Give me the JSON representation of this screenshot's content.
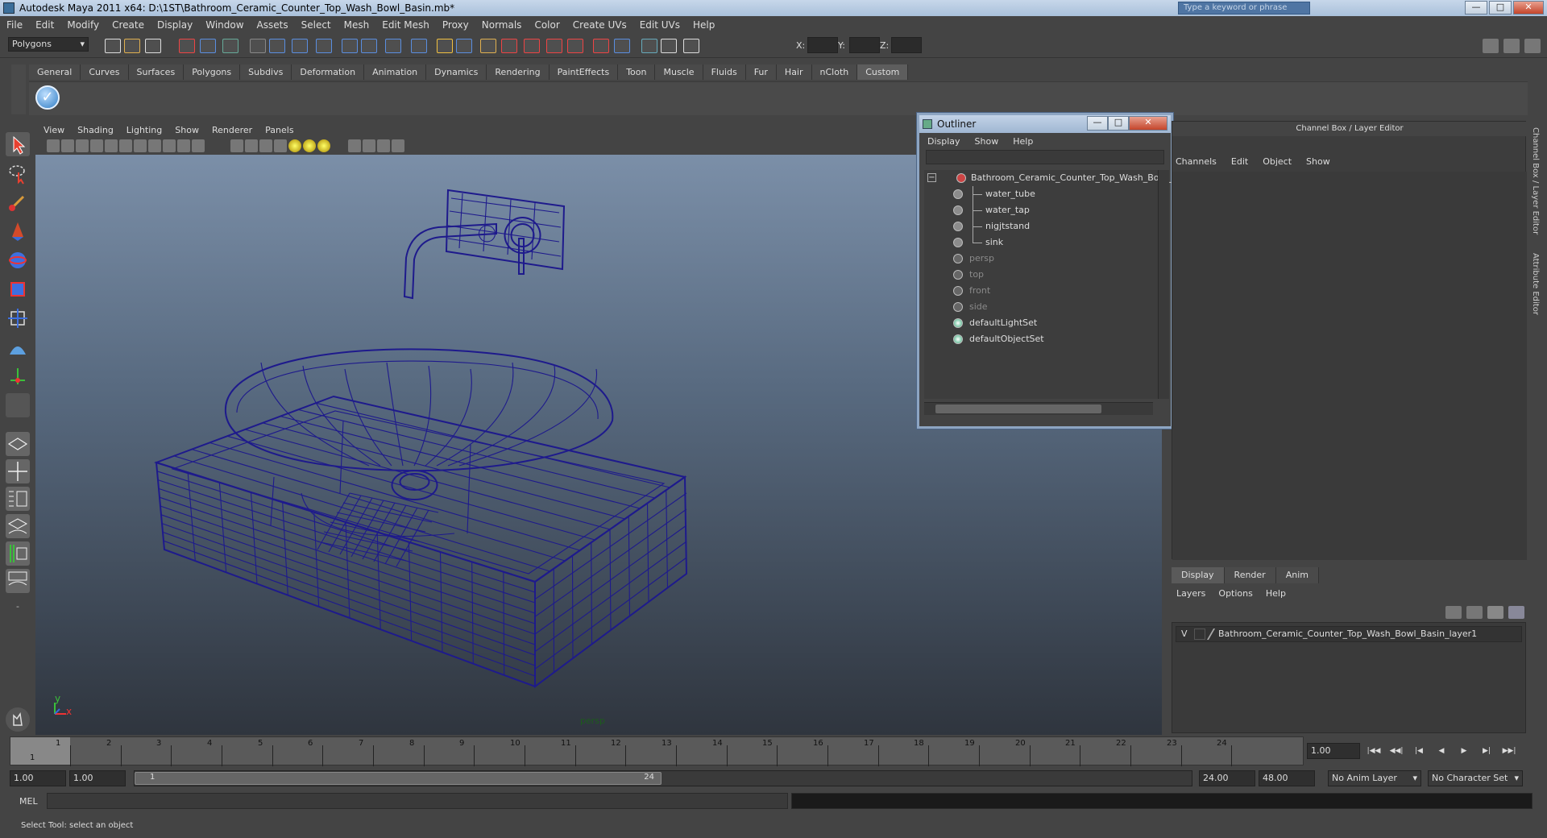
{
  "window": {
    "title": "Autodesk Maya 2011 x64: D:\\1ST\\Bathroom_Ceramic_Counter_Top_Wash_Bowl_Basin.mb*",
    "search_placeholder": "Type a keyword or phrase",
    "min_label": "—",
    "max_label": "□",
    "close_label": "✕"
  },
  "menu": [
    "File",
    "Edit",
    "Modify",
    "Create",
    "Display",
    "Window",
    "Assets",
    "Select",
    "Mesh",
    "Edit Mesh",
    "Proxy",
    "Normals",
    "Color",
    "Create UVs",
    "Edit UVs",
    "Help"
  ],
  "toolbar": {
    "mode": "Polygons",
    "x_label": "X:",
    "y_label": "Y:",
    "z_label": "Z:"
  },
  "shelf_tabs": [
    "General",
    "Curves",
    "Surfaces",
    "Polygons",
    "Subdivs",
    "Deformation",
    "Animation",
    "Dynamics",
    "Rendering",
    "PaintEffects",
    "Toon",
    "Muscle",
    "Fluids",
    "Fur",
    "Hair",
    "nCloth",
    "Custom"
  ],
  "shelf_active": "Custom",
  "viewport": {
    "menu": [
      "View",
      "Shading",
      "Lighting",
      "Show",
      "Renderer",
      "Panels"
    ],
    "camera": "persp",
    "axis_y": "y",
    "axis_x": "x",
    "wire_color": "#1e1a8c"
  },
  "outliner": {
    "title": "Outliner",
    "menu": [
      "Display",
      "Show",
      "Help"
    ],
    "root": "Bathroom_Ceramic_Counter_Top_Wash_Bowl_Basin",
    "children": [
      "water_tube",
      "water_tap",
      "nigjtstand",
      "sink"
    ],
    "cameras": [
      "persp",
      "top",
      "front",
      "side"
    ],
    "sets": [
      "defaultLightSet",
      "defaultObjectSet"
    ]
  },
  "channel_box": {
    "header": "Channel Box / Layer Editor",
    "menu": [
      "Channels",
      "Edit",
      "Object",
      "Show"
    ]
  },
  "layer_editor": {
    "tabs": [
      "Display",
      "Render",
      "Anim"
    ],
    "active_tab": "Display",
    "menu": [
      "Layers",
      "Options",
      "Help"
    ],
    "layer_visible": "V",
    "layer_name": "Bathroom_Ceramic_Counter_Top_Wash_Bowl_Basin_layer1"
  },
  "side_tabs": [
    "Channel Box / Layer Editor",
    "Attribute Editor"
  ],
  "timeline": {
    "start": 1,
    "end": 24,
    "current_frame": "1",
    "current_time": "1.00",
    "playback_icons": [
      "|◀◀",
      "◀◀|",
      "|◀",
      "◀",
      "▶",
      "▶|",
      "▶▶|"
    ]
  },
  "range": {
    "start_time": "1.00",
    "playback_start": "1.00",
    "handle_start": "1",
    "handle_end": "24",
    "playback_end": "24.00",
    "end_time": "48.00",
    "anim_layer": "No Anim Layer",
    "character_set": "No Character Set"
  },
  "command": {
    "label": "MEL"
  },
  "help_line": "Select Tool: select an object"
}
